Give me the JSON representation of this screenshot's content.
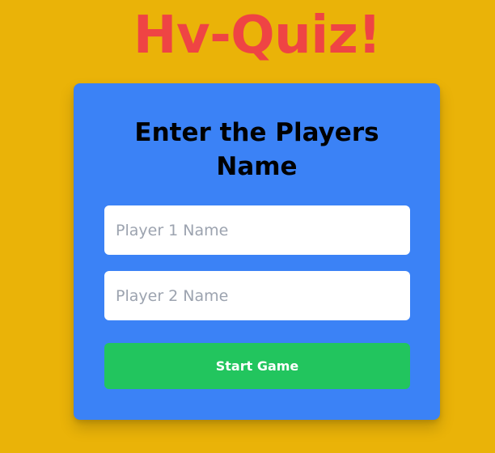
{
  "app": {
    "title": "Hv-Quiz!"
  },
  "form": {
    "heading": "Enter the Players Name",
    "player1_placeholder": "Player 1 Name",
    "player1_value": "",
    "player2_placeholder": "Player 2 Name",
    "player2_value": "",
    "start_label": "Start Game"
  },
  "colors": {
    "background": "#EAB308",
    "title": "#EF4444",
    "card": "#3B82F6",
    "button": "#22C55E"
  }
}
